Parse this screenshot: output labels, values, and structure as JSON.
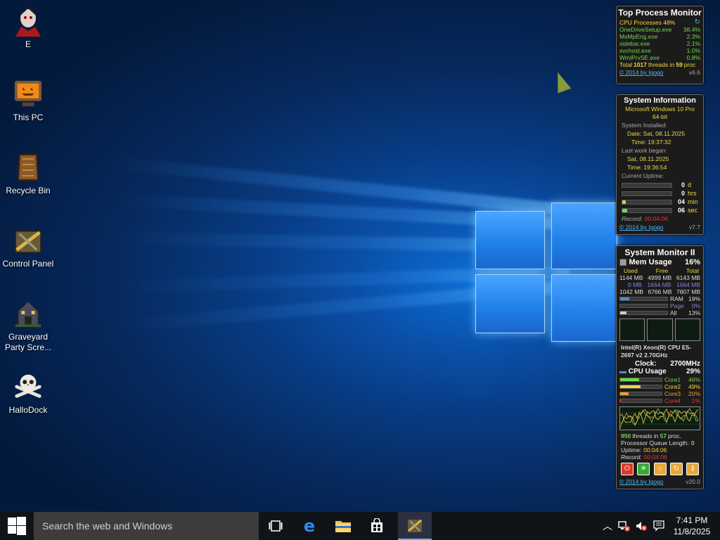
{
  "desktop": {
    "icons": [
      {
        "label": "E",
        "icon": "vampire-avatar-icon"
      },
      {
        "label": "This PC",
        "icon": "jack-o-lantern-monitor-icon"
      },
      {
        "label": "Recycle Bin",
        "icon": "coffin-bin-icon"
      },
      {
        "label": "Control Panel",
        "icon": "tools-crate-icon"
      },
      {
        "label": "Graveyard Party Scre...",
        "icon": "haunted-house-icon"
      },
      {
        "label": "HalloDock",
        "icon": "skull-crossbones-icon"
      }
    ]
  },
  "top_process_monitor": {
    "title": "Top Process Monitor",
    "header_label": "CPU Processes 48%",
    "processes": [
      {
        "name": "OneDriveSetup.exe",
        "value": "38.4%"
      },
      {
        "name": "MsMpEng.exe",
        "value": "2.3%"
      },
      {
        "name": "sidebar.exe",
        "value": "2.1%"
      },
      {
        "name": "svchost.exe",
        "value": "1.0%"
      },
      {
        "name": "WmiPrvSE.exe",
        "value": "0.8%"
      }
    ],
    "total_prefix": "Total",
    "total_threads": "1017",
    "threads_in": "threads in",
    "total_procs": "59",
    "procs_suffix": "proc",
    "copyright": "© 2014 by Igogo",
    "version": "v6.6"
  },
  "system_information": {
    "title": "System Information",
    "os_line1": "Microsoft Windows 10 Pro",
    "os_line2": "64-bit",
    "installed_label": "System Installed:",
    "installed_date": "Date: Sat, 08.11.2025",
    "installed_time": "Time: 19:37:32",
    "last_work_label": "Last work began:",
    "last_work_date": "Sat, 08.11.2025",
    "last_work_time": "Time: 19:36:54",
    "uptime_label": "Current Uptime:",
    "uptime": [
      {
        "value": "0",
        "unit": "d",
        "fraction": 0
      },
      {
        "value": "0",
        "unit": "hrs",
        "fraction": 0
      },
      {
        "value": "04",
        "unit": "min",
        "fraction": 0.07
      },
      {
        "value": "06",
        "unit": "sec",
        "fraction": 0.1
      }
    ],
    "record_label": "Record:",
    "record_value": "00:04:06",
    "copyright": "© 2014 by Igogo",
    "version": "v7.7"
  },
  "system_monitor": {
    "title": "System Monitor II",
    "mem_label": "Mem Usage",
    "mem_percent": "16%",
    "mem_headers": [
      "Used",
      "Free",
      "Total"
    ],
    "mem_rows": [
      [
        "1144 MB",
        "4999 MB",
        "6143 MB"
      ],
      [
        "0 MB",
        "1664 MB",
        "1664 MB"
      ],
      [
        "1042 MB",
        "6766 MB",
        "7807 MB"
      ]
    ],
    "mem_bars": [
      {
        "label": "RAM",
        "value": "19%",
        "fraction": 0.19
      },
      {
        "label": "Page",
        "value": "0%",
        "fraction": 0
      },
      {
        "label": "All",
        "value": "13%",
        "fraction": 0.13
      }
    ],
    "cpu_name": "Intel(R) Xeon(R) CPU E5-2697 v2 2.70GHz",
    "clock_label": "Clock:",
    "clock_value": "2700MHz",
    "cpu_label": "CPU Usage",
    "cpu_percent": "29%",
    "cores": [
      {
        "label": "Core1",
        "value": "46%",
        "fraction": 0.46,
        "color": "#6fd84b"
      },
      {
        "label": "Core2",
        "value": "49%",
        "fraction": 0.49,
        "color": "#f1d742"
      },
      {
        "label": "Core3",
        "value": "20%",
        "fraction": 0.2,
        "color": "#f0a030"
      },
      {
        "label": "Core4",
        "value": "1%",
        "fraction": 0.01,
        "color": "#e23a3a"
      }
    ],
    "threads": "950",
    "threads_in": "threads in",
    "procs": "57",
    "procs_suffix": "proc.",
    "queue_label": "Processor Queue Length:",
    "queue_value": "0",
    "uptime_label": "Uptime:",
    "uptime_value": "00:04:06",
    "record_label": "Record:",
    "record_value": "00:04:06",
    "copyright": "© 2014 by Igogo",
    "version": "v20.0"
  },
  "taskbar": {
    "search_placeholder": "Search the web and Windows",
    "time": "7:41 PM",
    "date": "11/8/2025"
  }
}
